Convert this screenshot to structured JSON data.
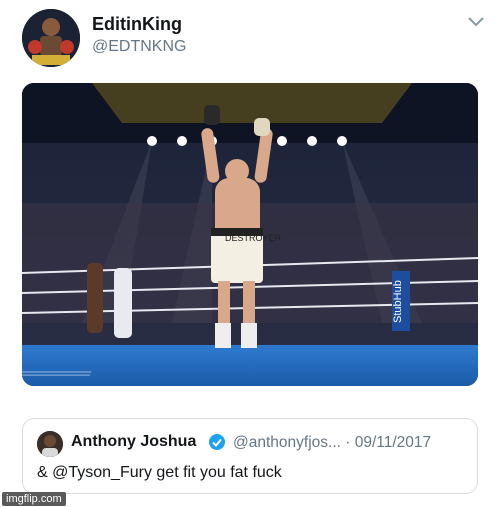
{
  "tweet": {
    "display_name": "EditinKing",
    "handle": "@EDTNKNG",
    "avatar_icon": "boxing-avatar-icon",
    "menu_icon": "chevron-down-icon",
    "media_description_icon": "boxing-photo",
    "media_text": {
      "shorts_word": "DESTROYER",
      "corner_ad": "StubHub"
    }
  },
  "quoted_tweet": {
    "display_name": "Anthony Joshua",
    "verified_icon": "verified-badge-icon",
    "handle_and_date": "@anthonyfjos... · 09/11/2017",
    "text": "& @Tyson_Fury get fit you fat fuck"
  },
  "watermark": "imgflip.com",
  "colors": {
    "name": "#14171a",
    "secondary": "#657786",
    "verified": "#1da1f2",
    "border": "#d8dee3"
  }
}
